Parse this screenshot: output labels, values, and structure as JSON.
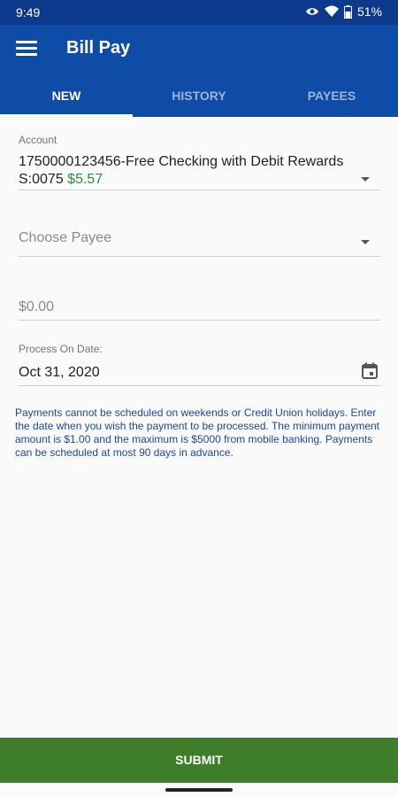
{
  "status_bar": {
    "time": "9:49",
    "battery": "51%"
  },
  "app_bar": {
    "title": "Bill Pay"
  },
  "tabs": [
    {
      "label": "NEW",
      "active": true
    },
    {
      "label": "HISTORY",
      "active": false
    },
    {
      "label": "PAYEES",
      "active": false
    }
  ],
  "form": {
    "account": {
      "label": "Account",
      "value": "1750000123456-Free Checking with Debit Rewards S:0075",
      "balance": "$5.57"
    },
    "payee": {
      "placeholder": "Choose Payee"
    },
    "amount": {
      "placeholder": "$0.00"
    },
    "process_date": {
      "label": "Process On Date:",
      "value": "Oct 31, 2020"
    }
  },
  "notice": "Payments cannot be scheduled on weekends or Credit Union holidays. Enter the date when you wish the payment to be processed. The minimum payment amount is $1.00 and the maximum is $5000 from mobile banking. Payments can be scheduled at most 90 days in advance.",
  "submit_label": "SUBMIT",
  "colors": {
    "app_bar": "#0f4ca8",
    "status_bar": "#0d3a8c",
    "balance": "#2e8b3c",
    "submit": "#3e7d2a",
    "notice": "#1a47a6"
  }
}
